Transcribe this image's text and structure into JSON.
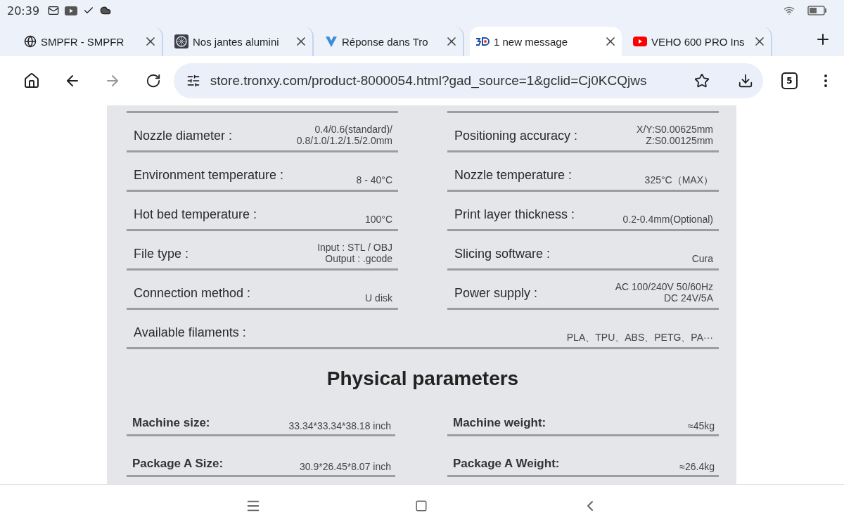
{
  "status_bar": {
    "time": "20:39"
  },
  "tabs": [
    {
      "title": "SMPFR - SMPFR",
      "selected": false
    },
    {
      "title": "Nos jantes alumini",
      "selected": false
    },
    {
      "title": "Réponse dans Tro",
      "selected": false
    },
    {
      "title": "1 new message",
      "selected": true
    },
    {
      "title": "VEHO 600 PRO Ins",
      "selected": false
    }
  ],
  "toolbar": {
    "url": "store.tronxy.com/product-8000054.html?gad_source=1&gclid=Cj0KCQjws",
    "tab_count": "5"
  },
  "specs": [
    {
      "kind": "half",
      "label": "Nozzle diameter :",
      "value": "0.4/0.6(standard)/\n0.8/1.0/1.2/1.5/2.0mm"
    },
    {
      "kind": "half",
      "label": "Positioning accuracy :",
      "value": "X/Y:S0.00625mm\nZ:S0.00125mm"
    },
    {
      "kind": "half",
      "label": "Environment temperature :",
      "value": "8 - 40°C"
    },
    {
      "kind": "half",
      "label": "Nozzle temperature :",
      "value": "325°C（MAX）"
    },
    {
      "kind": "half",
      "label": "Hot bed temperature :",
      "value": "100°C"
    },
    {
      "kind": "half",
      "label": "Print layer thickness :",
      "value": "0.2-0.4mm(Optional)"
    },
    {
      "kind": "half",
      "label": "File type :",
      "value": "Input : STL / OBJ\nOutput : .gcode"
    },
    {
      "kind": "half",
      "label": "Slicing software :",
      "value": "Cura"
    },
    {
      "kind": "half",
      "label": "Connection method :",
      "value": "U disk"
    },
    {
      "kind": "half",
      "label": "Power supply :",
      "value": "AC 100/240V 50/60Hz\nDC 24V/5A"
    },
    {
      "kind": "full",
      "label": "Available filaments :",
      "value": "PLA、TPU、ABS、PETG、PA···"
    }
  ],
  "physical": {
    "heading": "Physical parameters",
    "rows": [
      {
        "label": "Machine size:",
        "value": "33.34*33.34*38.18 inch"
      },
      {
        "label": "Machine weight:",
        "value": "≈45kg"
      },
      {
        "label": "Package A Size:",
        "value": "30.9*26.45*8.07 inch"
      },
      {
        "label": "Package A Weight:",
        "value": "≈26.4kg"
      }
    ]
  }
}
